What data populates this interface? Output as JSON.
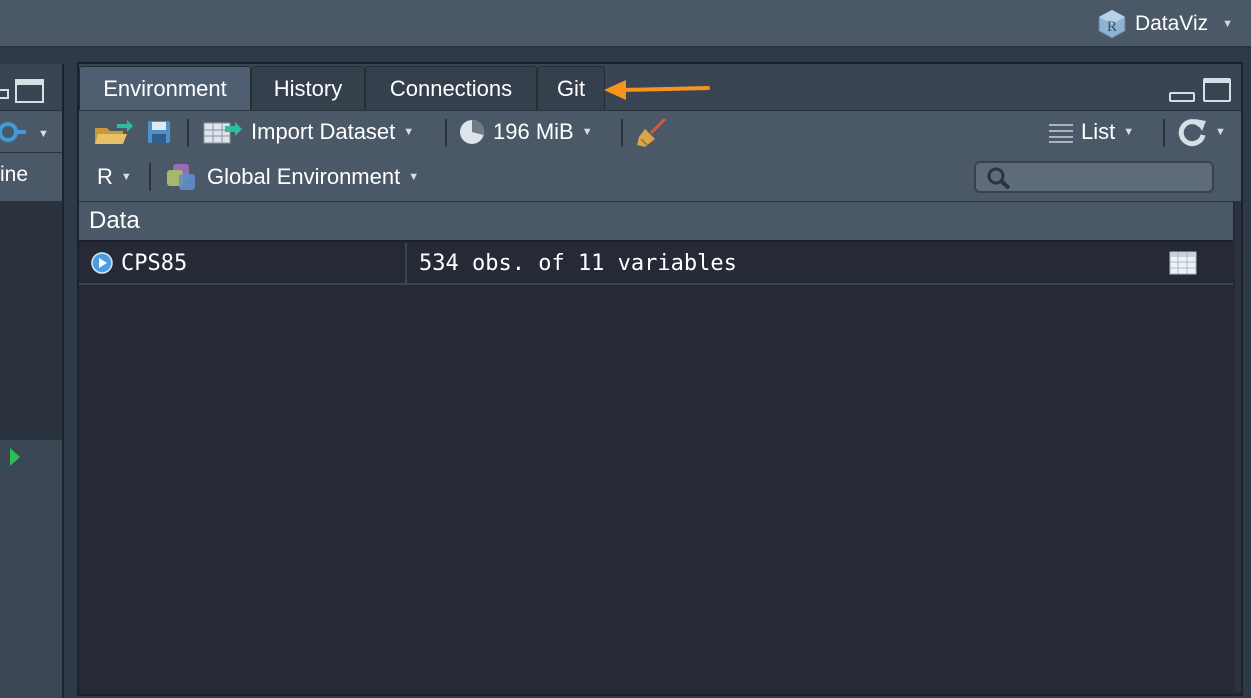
{
  "project": {
    "name": "DataViz"
  },
  "left_pane": {
    "partial_label": "ine"
  },
  "tabs": [
    {
      "label": "Environment",
      "active": true
    },
    {
      "label": "History",
      "active": false
    },
    {
      "label": "Connections",
      "active": false
    },
    {
      "label": "Git",
      "active": false
    }
  ],
  "toolbar": {
    "import_label": "Import Dataset",
    "memory_label": "196 MiB",
    "view_label": "List"
  },
  "subbar": {
    "language": "R",
    "environment": "Global Environment",
    "search_placeholder": ""
  },
  "data_section": {
    "header": "Data",
    "rows": [
      {
        "name": "CPS85",
        "value": "534 obs. of 11 variables"
      }
    ]
  },
  "colors": {
    "accent_arrow": "#f7941d",
    "background": "#262a36",
    "toolbar": "#4a5868"
  }
}
